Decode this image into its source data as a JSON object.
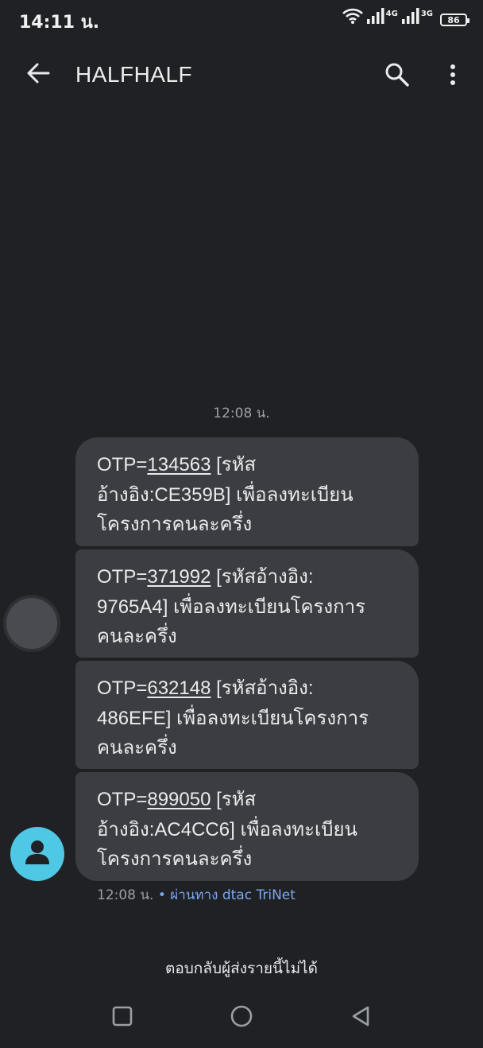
{
  "status_bar": {
    "time": "14:11 น.",
    "network_1": "4G",
    "network_2": "3G",
    "battery": "86"
  },
  "app_bar": {
    "title": "HALFHALF",
    "back_icon": "arrow-back-icon",
    "search_icon": "search-icon",
    "more_icon": "more-vert-icon"
  },
  "conversation": {
    "date_separator": "12:08 น.",
    "messages": [
      {
        "prefix": "OTP=",
        "code": "134563",
        "line1_rest": " [รหัส",
        "line2": "อ้างอิง:CE359B] เพื่อลงทะเบียน",
        "line3": "โครงการคนละครึ่ง"
      },
      {
        "prefix": "OTP=",
        "code": "371992",
        "line1_rest": " [รหัสอ้างอิง:",
        "line2": "9765A4] เพื่อลงทะเบียนโครงการ",
        "line3": "คนละครึ่ง"
      },
      {
        "prefix": "OTP=",
        "code": "632148",
        "line1_rest": " [รหัสอ้างอิง:",
        "line2": "486EFE] เพื่อลงทะเบียนโครงการ",
        "line3": "คนละครึ่ง"
      },
      {
        "prefix": "OTP=",
        "code": "899050",
        "line1_rest": " [รหัส",
        "line2": "อ้างอิง:AC4CC6] เพื่อลงทะเบียน",
        "line3": "โครงการคนละครึ่ง"
      }
    ],
    "meta_time": "12:08 น.",
    "meta_via": " • ผ่านทาง dtac TriNet",
    "no_reply_notice": "ตอบกลับผู้ส่งรายนี้ไม่ได้"
  },
  "colors": {
    "background": "#202124",
    "bubble": "#3c3d42",
    "avatar": "#4ec8e4",
    "link": "#7ba7ee"
  },
  "nav_bar": {
    "recents_icon": "square-icon",
    "home_icon": "circle-icon",
    "back_icon": "triangle-back-icon"
  }
}
